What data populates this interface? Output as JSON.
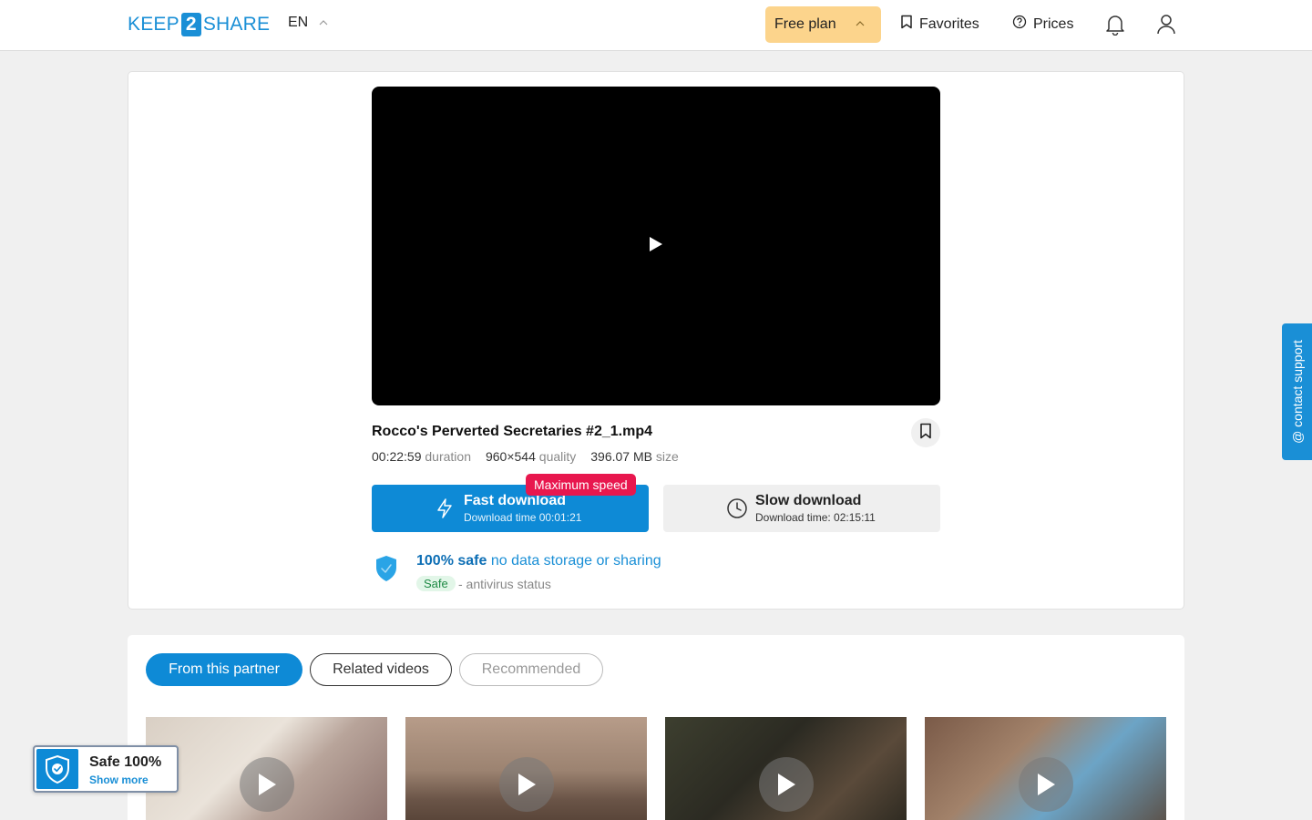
{
  "header": {
    "logo": {
      "left": "KEEP",
      "mid": "2",
      "right": "SHARE"
    },
    "lang": "EN",
    "plan_label": "Free plan",
    "favorites_label": "Favorites",
    "prices_label": "Prices"
  },
  "file": {
    "name": "Rocco's Perverted Secretaries #2_1.mp4",
    "duration_value": "00:22:59",
    "duration_label": "duration",
    "quality_value": "960×544",
    "quality_label": "quality",
    "size_value": "396.07 MB",
    "size_label": "size"
  },
  "download": {
    "fast_title": "Fast download",
    "fast_sub": "Download time 00:01:21",
    "max_speed": "Maximum speed",
    "slow_title": "Slow download",
    "slow_sub": "Download time: 02:15:11"
  },
  "safety": {
    "bold": "100% safe",
    "rest": "no data storage or sharing",
    "badge": "Safe",
    "status": "- antivirus status"
  },
  "tabs": [
    "From this partner",
    "Related videos",
    "Recommended"
  ],
  "support_label": "@ contact support",
  "safe_widget": {
    "title": "Safe 100%",
    "link": "Show more"
  },
  "colors": {
    "accent": "#0e8ad6",
    "plan": "#fcd48c",
    "max_speed": "#e8174e",
    "safe_badge_bg": "#e2f6e8"
  }
}
